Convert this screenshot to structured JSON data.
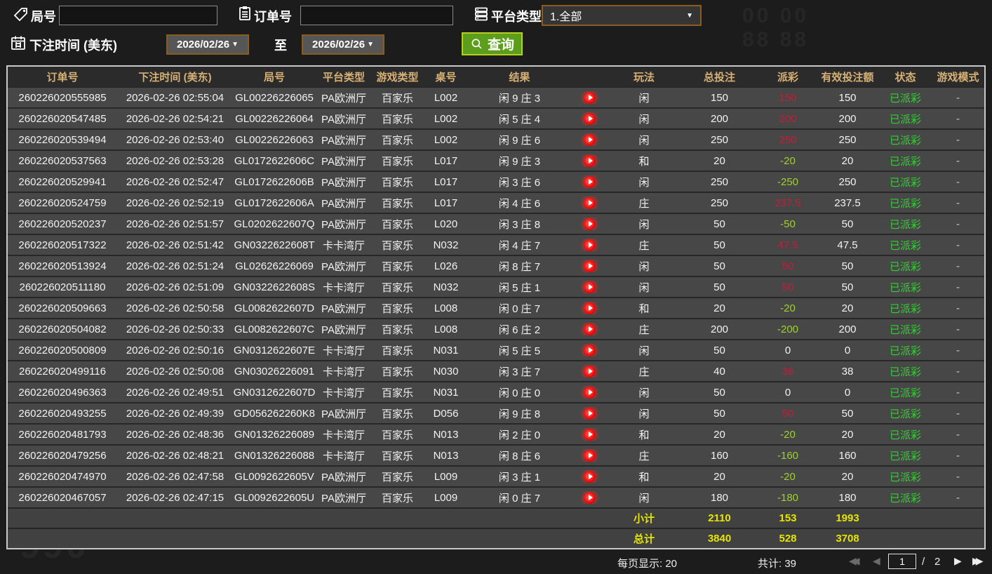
{
  "filters": {
    "game_no_label": "局号",
    "order_no_label": "订单号",
    "platform_label": "平台类型",
    "platform_value": "1.全部",
    "bet_time_label": "下注时间 (美东)",
    "date_from": "2026/02/26",
    "to_label": "至",
    "date_to": "2026/02/26",
    "query_label": "查询",
    "caret": "▼"
  },
  "table": {
    "headers": [
      "订单号",
      "下注时间 (美东)",
      "局号",
      "平台类型",
      "游戏类型",
      "桌号",
      "结果",
      "玩法",
      "总投注",
      "派彩",
      "有效投注额",
      "状态",
      "游戏模式"
    ],
    "rows": [
      {
        "order": "260226020555985",
        "time": "2026-02-26 02:55:04",
        "game": "GL00226226065",
        "platform": "PA欧洲厅",
        "type": "百家乐",
        "table": "L002",
        "result": "闲 9 庄 3",
        "play": "闲",
        "bet": "150",
        "payout": "150",
        "payout_type": "win",
        "valid": "150",
        "status": "已派彩",
        "mode": "-"
      },
      {
        "order": "260226020547485",
        "time": "2026-02-26 02:54:21",
        "game": "GL00226226064",
        "platform": "PA欧洲厅",
        "type": "百家乐",
        "table": "L002",
        "result": "闲 5 庄 4",
        "play": "闲",
        "bet": "200",
        "payout": "200",
        "payout_type": "win",
        "valid": "200",
        "status": "已派彩",
        "mode": "-"
      },
      {
        "order": "260226020539494",
        "time": "2026-02-26 02:53:40",
        "game": "GL00226226063",
        "platform": "PA欧洲厅",
        "type": "百家乐",
        "table": "L002",
        "result": "闲 9 庄 6",
        "play": "闲",
        "bet": "250",
        "payout": "250",
        "payout_type": "win",
        "valid": "250",
        "status": "已派彩",
        "mode": "-"
      },
      {
        "order": "260226020537563",
        "time": "2026-02-26 02:53:28",
        "game": "GL0172622606C",
        "platform": "PA欧洲厅",
        "type": "百家乐",
        "table": "L017",
        "result": "闲 9 庄 3",
        "play": "和",
        "bet": "20",
        "payout": "-20",
        "payout_type": "loss",
        "valid": "20",
        "status": "已派彩",
        "mode": "-"
      },
      {
        "order": "260226020529941",
        "time": "2026-02-26 02:52:47",
        "game": "GL0172622606B",
        "platform": "PA欧洲厅",
        "type": "百家乐",
        "table": "L017",
        "result": "闲 3 庄 6",
        "play": "闲",
        "bet": "250",
        "payout": "-250",
        "payout_type": "loss",
        "valid": "250",
        "status": "已派彩",
        "mode": "-"
      },
      {
        "order": "260226020524759",
        "time": "2026-02-26 02:52:19",
        "game": "GL0172622606A",
        "platform": "PA欧洲厅",
        "type": "百家乐",
        "table": "L017",
        "result": "闲 4 庄 6",
        "play": "庄",
        "bet": "250",
        "payout": "237.5",
        "payout_type": "win",
        "valid": "237.5",
        "status": "已派彩",
        "mode": "-"
      },
      {
        "order": "260226020520237",
        "time": "2026-02-26 02:51:57",
        "game": "GL0202622607Q",
        "platform": "PA欧洲厅",
        "type": "百家乐",
        "table": "L020",
        "result": "闲 3 庄 8",
        "play": "闲",
        "bet": "50",
        "payout": "-50",
        "payout_type": "loss",
        "valid": "50",
        "status": "已派彩",
        "mode": "-"
      },
      {
        "order": "260226020517322",
        "time": "2026-02-26 02:51:42",
        "game": "GN0322622608T",
        "platform": "卡卡湾厅",
        "type": "百家乐",
        "table": "N032",
        "result": "闲 4 庄 7",
        "play": "庄",
        "bet": "50",
        "payout": "47.5",
        "payout_type": "win",
        "valid": "47.5",
        "status": "已派彩",
        "mode": "-"
      },
      {
        "order": "260226020513924",
        "time": "2026-02-26 02:51:24",
        "game": "GL02626226069",
        "platform": "PA欧洲厅",
        "type": "百家乐",
        "table": "L026",
        "result": "闲 8 庄 7",
        "play": "闲",
        "bet": "50",
        "payout": "50",
        "payout_type": "win",
        "valid": "50",
        "status": "已派彩",
        "mode": "-"
      },
      {
        "order": "260226020511180",
        "time": "2026-02-26 02:51:09",
        "game": "GN0322622608S",
        "platform": "卡卡湾厅",
        "type": "百家乐",
        "table": "N032",
        "result": "闲 5 庄 1",
        "play": "闲",
        "bet": "50",
        "payout": "50",
        "payout_type": "win",
        "valid": "50",
        "status": "已派彩",
        "mode": "-"
      },
      {
        "order": "260226020509663",
        "time": "2026-02-26 02:50:58",
        "game": "GL0082622607D",
        "platform": "PA欧洲厅",
        "type": "百家乐",
        "table": "L008",
        "result": "闲 0 庄 7",
        "play": "和",
        "bet": "20",
        "payout": "-20",
        "payout_type": "loss",
        "valid": "20",
        "status": "已派彩",
        "mode": "-"
      },
      {
        "order": "260226020504082",
        "time": "2026-02-26 02:50:33",
        "game": "GL0082622607C",
        "platform": "PA欧洲厅",
        "type": "百家乐",
        "table": "L008",
        "result": "闲 6 庄 2",
        "play": "庄",
        "bet": "200",
        "payout": "-200",
        "payout_type": "loss",
        "valid": "200",
        "status": "已派彩",
        "mode": "-"
      },
      {
        "order": "260226020500809",
        "time": "2026-02-26 02:50:16",
        "game": "GN0312622607E",
        "platform": "卡卡湾厅",
        "type": "百家乐",
        "table": "N031",
        "result": "闲 5 庄 5",
        "play": "闲",
        "bet": "50",
        "payout": "0",
        "payout_type": "zero",
        "valid": "0",
        "status": "已派彩",
        "mode": "-"
      },
      {
        "order": "260226020499116",
        "time": "2026-02-26 02:50:08",
        "game": "GN03026226091",
        "platform": "卡卡湾厅",
        "type": "百家乐",
        "table": "N030",
        "result": "闲 3 庄 7",
        "play": "庄",
        "bet": "40",
        "payout": "38",
        "payout_type": "win",
        "valid": "38",
        "status": "已派彩",
        "mode": "-"
      },
      {
        "order": "260226020496363",
        "time": "2026-02-26 02:49:51",
        "game": "GN0312622607D",
        "platform": "卡卡湾厅",
        "type": "百家乐",
        "table": "N031",
        "result": "闲 0 庄 0",
        "play": "闲",
        "bet": "50",
        "payout": "0",
        "payout_type": "zero",
        "valid": "0",
        "status": "已派彩",
        "mode": "-"
      },
      {
        "order": "260226020493255",
        "time": "2026-02-26 02:49:39",
        "game": "GD056262260K8",
        "platform": "PA欧洲厅",
        "type": "百家乐",
        "table": "D056",
        "result": "闲 9 庄 8",
        "play": "闲",
        "bet": "50",
        "payout": "50",
        "payout_type": "win",
        "valid": "50",
        "status": "已派彩",
        "mode": "-"
      },
      {
        "order": "260226020481793",
        "time": "2026-02-26 02:48:36",
        "game": "GN01326226089",
        "platform": "卡卡湾厅",
        "type": "百家乐",
        "table": "N013",
        "result": "闲 2 庄 0",
        "play": "和",
        "bet": "20",
        "payout": "-20",
        "payout_type": "loss",
        "valid": "20",
        "status": "已派彩",
        "mode": "-"
      },
      {
        "order": "260226020479256",
        "time": "2026-02-26 02:48:21",
        "game": "GN01326226088",
        "platform": "卡卡湾厅",
        "type": "百家乐",
        "table": "N013",
        "result": "闲 8 庄 6",
        "play": "庄",
        "bet": "160",
        "payout": "-160",
        "payout_type": "loss",
        "valid": "160",
        "status": "已派彩",
        "mode": "-"
      },
      {
        "order": "260226020474970",
        "time": "2026-02-26 02:47:58",
        "game": "GL0092622605V",
        "platform": "PA欧洲厅",
        "type": "百家乐",
        "table": "L009",
        "result": "闲 3 庄 1",
        "play": "和",
        "bet": "20",
        "payout": "-20",
        "payout_type": "loss",
        "valid": "20",
        "status": "已派彩",
        "mode": "-"
      },
      {
        "order": "260226020467057",
        "time": "2026-02-26 02:47:15",
        "game": "GL0092622605U",
        "platform": "PA欧洲厅",
        "type": "百家乐",
        "table": "L009",
        "result": "闲 0 庄 7",
        "play": "闲",
        "bet": "180",
        "payout": "-180",
        "payout_type": "loss",
        "valid": "180",
        "status": "已派彩",
        "mode": "-"
      }
    ],
    "subtotal": {
      "label": "小计",
      "bet": "2110",
      "payout": "153",
      "valid": "1993"
    },
    "total": {
      "label": "总计",
      "bet": "3840",
      "payout": "528",
      "valid": "3708"
    }
  },
  "footer": {
    "per_page": "每页显示: 20",
    "total_count": "共计: 39",
    "first": "◀◀",
    "prev": "◀",
    "page": "1",
    "page_sep": "/",
    "page_total": "2",
    "next": "▶",
    "last": "▶▶"
  },
  "watermarks": {
    "bottom_left": "990",
    "top_right": "00 00\n88 88"
  },
  "colors": {
    "header_gold": "#d7b174",
    "payout_win_red": "#c21e3c",
    "payout_loss_green": "#9ed22a",
    "status_paid_green": "#2ed22e",
    "totals_yellow": "#e5e500",
    "query_green": "#5c9e1c",
    "query_border": "#b9cf1f",
    "date_border": "#8a5c1e",
    "row_bg": "#474747",
    "page_bg": "#1c1c1c"
  }
}
